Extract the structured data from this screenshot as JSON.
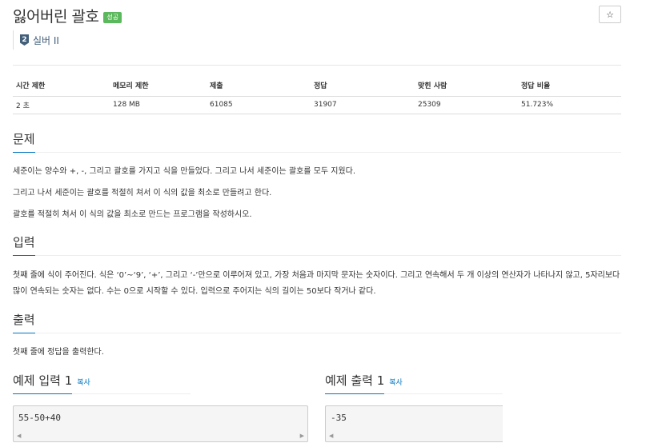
{
  "problem": {
    "title": "잃어버린 괄호",
    "result_badge": "성공",
    "star_icon": "☆",
    "tier": {
      "number": "2",
      "label": "실버 II"
    }
  },
  "info_table": {
    "headers": [
      "시간 제한",
      "메모리 제한",
      "제출",
      "정답",
      "맞힌 사람",
      "정답 비율"
    ],
    "values": [
      "2 초",
      "128 MB",
      "61085",
      "31907",
      "25309",
      "51.723%"
    ]
  },
  "sections": {
    "problem": {
      "heading": "문제",
      "paragraphs": [
        "세준이는 양수와 +, -, 그리고 괄호를 가지고 식을 만들었다. 그리고 나서 세준이는 괄호를 모두 지웠다.",
        "그리고 나서 세준이는 괄호를 적절히 쳐서 이 식의 값을 최소로 만들려고 한다.",
        "괄호를 적절히 쳐서 이 식의 값을 최소로 만드는 프로그램을 작성하시오."
      ]
    },
    "input": {
      "heading": "입력",
      "text": "첫째 줄에 식이 주어진다. 식은 ‘0’~‘9’, ‘+’, 그리고 ‘-’만으로 이루어져 있고, 가장 처음과 마지막 문자는 숫자이다. 그리고 연속해서 두 개 이상의 연산자가 나타나지 않고, 5자리보다 많이 연속되는 숫자는 없다. 수는 0으로 시작할 수 있다. 입력으로 주어지는 식의 길이는 50보다 작거나 같다."
    },
    "output": {
      "heading": "출력",
      "text": "첫째 줄에 정답을 출력한다."
    }
  },
  "samples": {
    "input": {
      "heading": "예제 입력 1",
      "copy_label": "복사",
      "content": "55-50+40"
    },
    "output": {
      "heading": "예제 출력 1",
      "copy_label": "복사",
      "content": "-35"
    },
    "scroll_left": "◀",
    "scroll_right": "▶"
  }
}
